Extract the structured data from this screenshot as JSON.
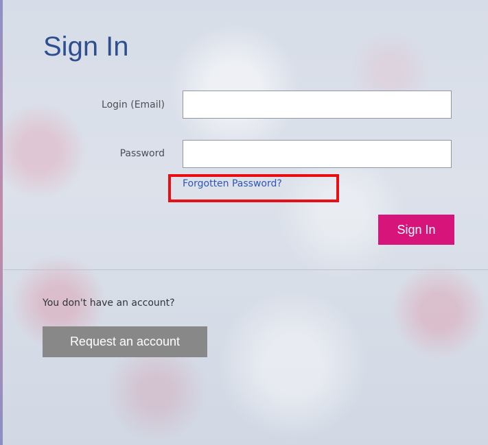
{
  "page": {
    "title": "Sign In"
  },
  "form": {
    "login": {
      "label": "Login (Email)",
      "value": "",
      "placeholder": ""
    },
    "password": {
      "label": "Password",
      "value": "",
      "placeholder": ""
    },
    "forgotten_password": "Forgotten Password?",
    "sign_in_button": "Sign In"
  },
  "account": {
    "prompt": "You don't have an account?",
    "request_button": "Request an account"
  },
  "colors": {
    "title": "#2e4f8f",
    "link": "#2f56b6",
    "primary_button": "#d7147a",
    "secondary_button": "#888888",
    "highlight": "#ea0e14"
  }
}
